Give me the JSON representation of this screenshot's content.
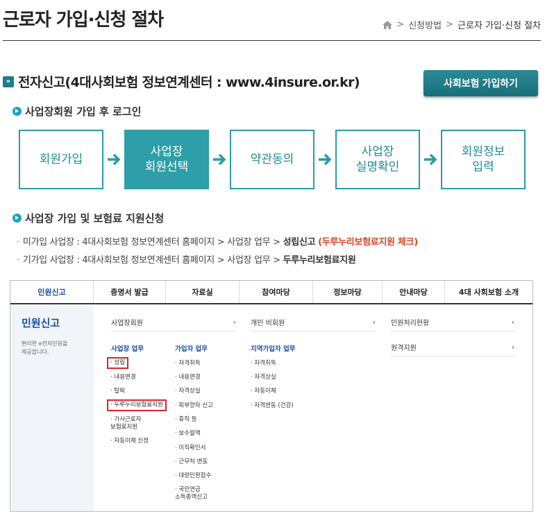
{
  "header": {
    "title": "근로자 가입·신청 절차",
    "breadcrumb": [
      "신청방법",
      "근로자 가입·신청 절차"
    ]
  },
  "section": {
    "icon": "»",
    "title": "전자신고(4대사회보험 정보연계센터 : www.4insure.or.kr)",
    "join_button": "사회보험 가입하기"
  },
  "login": {
    "heading": "사업장회원 가입 후 로그인",
    "steps": [
      "회원가입",
      "사업장\n회원선택",
      "약관동의",
      "사업장\n실명확인",
      "회원정보\n입력"
    ],
    "active_step": 1
  },
  "apply": {
    "heading": "사업장 가입 및 보험료 지원신청",
    "line1_prefix": "미가입 사업장 : 4대사회보험 정보연계센터 홈페이지 > 사업장 업무 > ",
    "line1_strong": "성립신고",
    "line1_red": "(두루누리보험료지원 체크)",
    "line2_prefix": "기가입 사업장 : 4대사회보험 정보연계센터 홈페이지 > 사업장 업무 > ",
    "line2_strong": "두루누리보험료지원"
  },
  "site": {
    "gnb": [
      "민원신고",
      "증명서 발급",
      "자료실",
      "참여마당",
      "정보마당",
      "안내마당",
      "4대 사회보험 소개"
    ],
    "side_title": "민원신고",
    "side_desc": "편리한 e전자민원을\n제공합니다.",
    "col1_link": "사업장회원",
    "col2_link": "개인 비회원",
    "col3_links": [
      "민원처리현황",
      "원격지원"
    ],
    "biz_title": "사업장 업무",
    "biz_items": [
      "성립",
      "내용변경",
      "탈퇴",
      "두루누리보험료지원",
      "가사근로자\n보험료지원",
      "자동이체 신청"
    ],
    "sub_title": "가입자 업무",
    "sub_items": [
      "자격취득",
      "내용변경",
      "자격상실",
      "피부양자 신고",
      "휴직 등",
      "보수월액",
      "이직확인서",
      "근무처 변동",
      "대량민원접수",
      "국민연금\n소득총액신고"
    ],
    "region_title": "지역가입자 업무",
    "region_items": [
      "자격취득",
      "자격상실",
      "자동이체",
      "자격변동 (건강)"
    ]
  }
}
